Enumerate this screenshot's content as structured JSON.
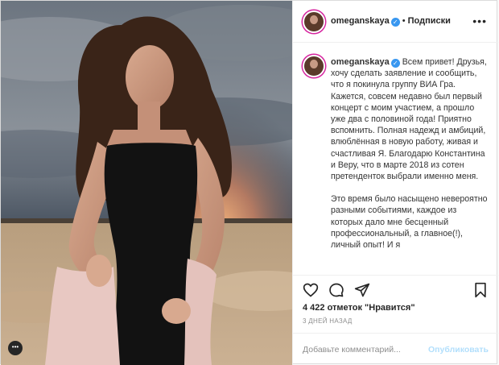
{
  "header": {
    "username": "omeganskaya",
    "separator": "•",
    "follow_label": "Подписки",
    "more_label": "•••"
  },
  "caption": {
    "username": "omeganskaya",
    "paragraph1": "Всем привет! Друзья, хочу сделать заявление и сообщить, что я покинула группу ВИА Гра. Кажется, совсем недавно был первый концерт с моим участием, а прошло уже два с половиной года! Приятно вспомнить. Полная надежд и амбиций, влюблённая в новую работу, живая и счастливая Я. Благодарю Константина и Веру, что в марте 2018 из сотен претенденток выбрали именно меня.",
    "paragraph2": "Это время было насыщено невероятно разными событиями, каждое из которых дало мне бесценный профессиональный, а главное(!), личный опыт! И я"
  },
  "actions": {
    "like_icon": "heart-icon",
    "comment_icon": "comment-icon",
    "share_icon": "share-icon",
    "save_icon": "bookmark-icon"
  },
  "stats": {
    "likes_text": "4 422 отметок \"Нравится\"",
    "time_text": "3 ДНЕЙ НАЗАД"
  },
  "add_comment": {
    "placeholder": "Добавьте комментарий...",
    "post_label": "Опубликовать"
  },
  "photo": {
    "more_label": "•••"
  },
  "colors": {
    "verified": "#3897f0",
    "post_button_disabled": "#b2dffc",
    "border": "#dbdbdb"
  }
}
